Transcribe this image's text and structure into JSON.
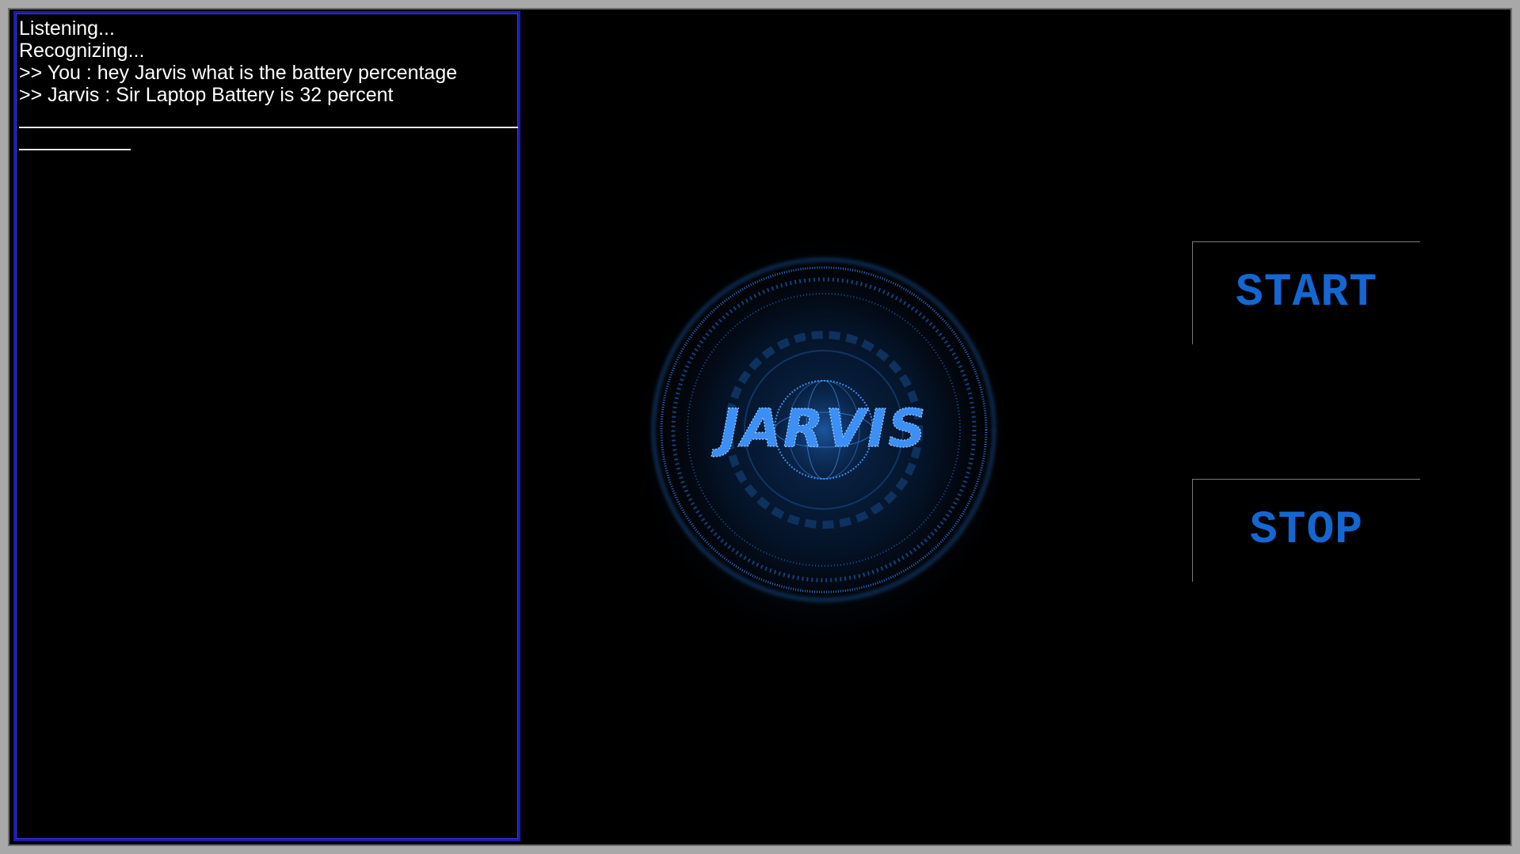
{
  "log": {
    "lines": [
      "Listening...",
      "Recognizing...",
      ">> You : hey Jarvis what is the battery percentage",
      ">> Jarvis : Sir Laptop Battery is 32 percent"
    ]
  },
  "logo": {
    "text": "JARVIS",
    "icon": "jarvis-logo-icon",
    "color": "#2f86ff"
  },
  "controls": {
    "start_label": "START",
    "stop_label": "STOP",
    "label_color": "#1467d2"
  }
}
